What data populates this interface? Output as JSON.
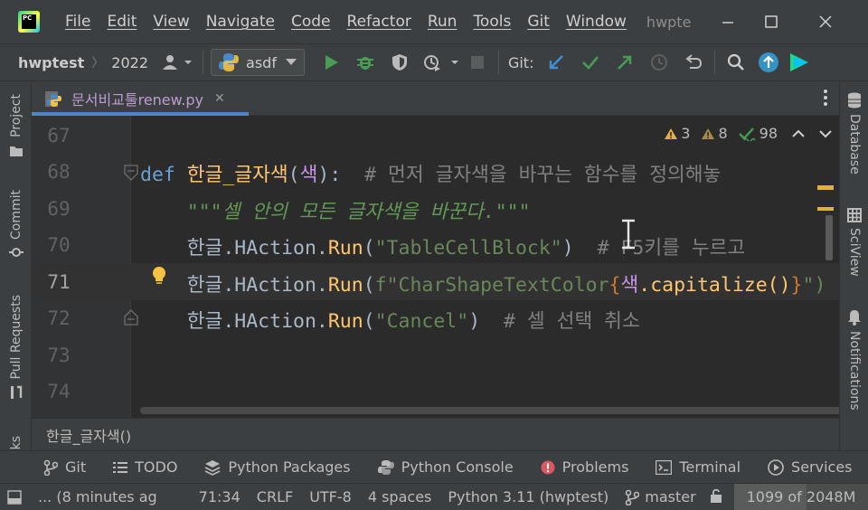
{
  "window": {
    "project_title": "hwpte",
    "menu": [
      "File",
      "Edit",
      "View",
      "Navigate",
      "Code",
      "Refactor",
      "Run",
      "Tools",
      "Git",
      "Window"
    ]
  },
  "navbar": {
    "project": "hwptest",
    "folder": "2022",
    "run_config": "asdf",
    "git_label": "Git:"
  },
  "left_tools": [
    "Project",
    "Commit",
    "Pull Requests",
    "ks"
  ],
  "right_tools": [
    "Database",
    "SciView",
    "Notifications"
  ],
  "tab": {
    "filename": "문서비교툴renew.py"
  },
  "inspections": {
    "warnings": "3",
    "weak_warnings": "8",
    "typos": "98"
  },
  "editor": {
    "line_numbers": [
      "67",
      "68",
      "69",
      "70",
      "71",
      "72",
      "73",
      "74"
    ],
    "current_line": "71",
    "line68": {
      "kw": "def",
      "name": "한글_글자색",
      "open": "(",
      "param": "색",
      "close": "):",
      "comment": "# 먼저 글자색을 바꾸는 함수를 정의해놓"
    },
    "line69": {
      "doc": "\"\"\"셀 안의 모든 글자색을 바꾼다.\"\"\""
    },
    "line70": {
      "obj": "한글",
      "dot1": ".HAction.",
      "run": "Run",
      "open": "(",
      "str": "\"TableCellBlock\"",
      "close": ")",
      "comment": "# F5키를 누르고"
    },
    "line71": {
      "obj": "한글",
      "dot1": ".HAction.",
      "run": "Run",
      "open": "(",
      "fprefix": "f\"CharShapeTextColor",
      "brace_open": "{",
      "var": "색",
      "method": ".capitalize()",
      "brace_close": "}",
      "tail": "\")"
    },
    "line72": {
      "obj": "한글",
      "dot1": ".HAction.",
      "run": "Run",
      "open": "(",
      "str": "\"Cancel\"",
      "close": ")",
      "comment": "# 셀 선택 취소"
    }
  },
  "breadcrumb": "한글_글자색()",
  "bottom_tools": [
    "Git",
    "TODO",
    "Python Packages",
    "Python Console",
    "Problems",
    "Terminal",
    "Services"
  ],
  "status": {
    "message": "... (8 minutes ag",
    "position": "71:34",
    "line_sep": "CRLF",
    "encoding": "UTF-8",
    "indent": "4 spaces",
    "interpreter": "Python 3.11 (hwptest)",
    "branch": "master",
    "memory": "1099 of 2048M",
    "memory_used_fraction": 0.54
  },
  "colors": {
    "background": "#2b2b2b",
    "accent_blue": "#4a88c7",
    "run_green": "#499c54",
    "keyword": "#6a9fd4",
    "function": "#ffc66d",
    "comment": "#808080",
    "string": "#6a8759"
  }
}
